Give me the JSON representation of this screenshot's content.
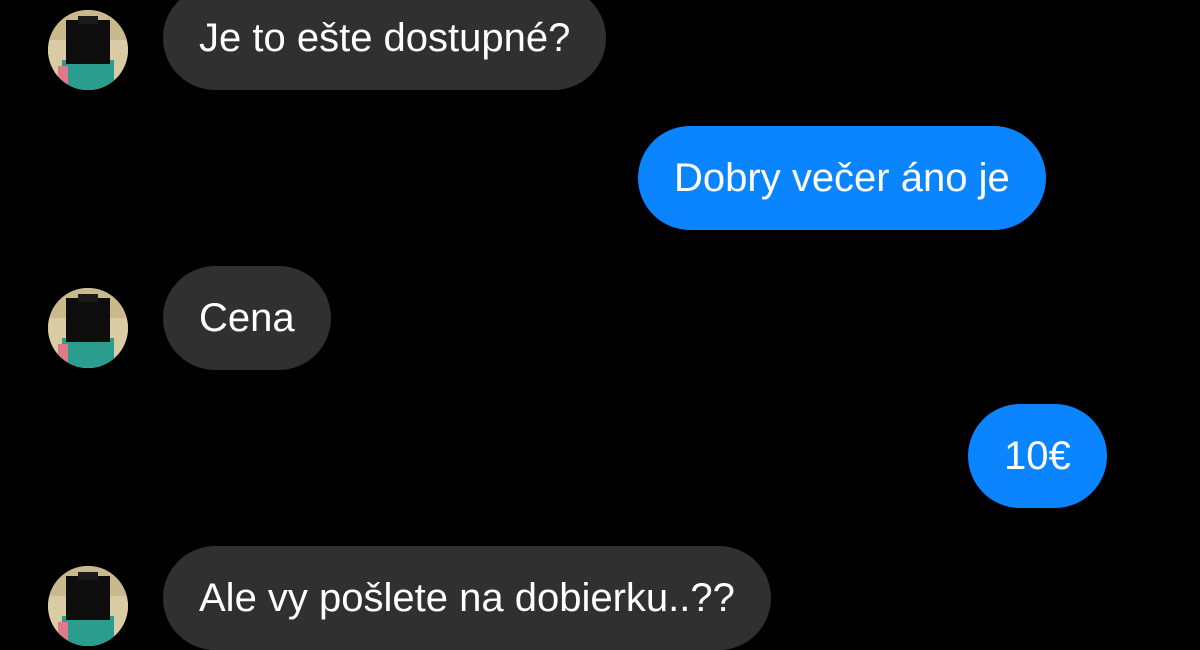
{
  "conversation": {
    "messages": [
      {
        "direction": "incoming",
        "text": "Je to ešte dostupné?"
      },
      {
        "direction": "outgoing",
        "text": "Dobry večer áno je"
      },
      {
        "direction": "incoming",
        "text": "Cena"
      },
      {
        "direction": "outgoing",
        "text": "10€"
      },
      {
        "direction": "incoming",
        "text": "Ale vy pošlete na dobierku..??"
      }
    ]
  },
  "colors": {
    "background": "#000000",
    "incoming_bubble": "#303030",
    "outgoing_bubble": "#0a84ff",
    "text": "#ffffff"
  },
  "icons": {
    "avatar": "contact-avatar-icon"
  }
}
